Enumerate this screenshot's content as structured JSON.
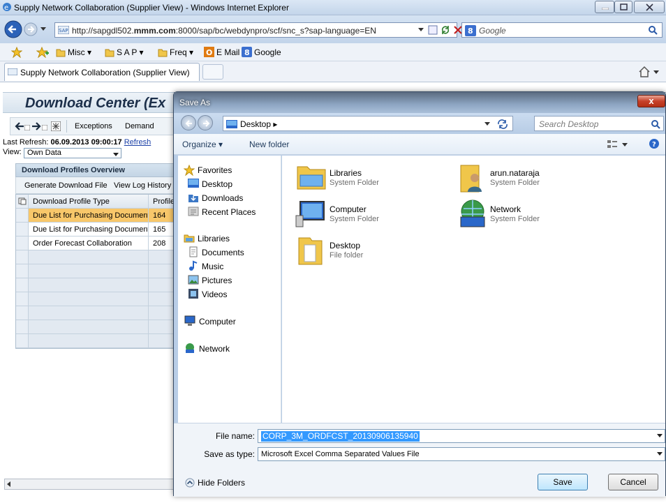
{
  "browser": {
    "window_title": "Supply Network Collaboration (Supplier View) - Windows Internet Explorer",
    "url_prefix": "http://sapgdl502.",
    "url_bold": "mmm.com",
    "url_suffix": ":8000/sap/bc/webdynpro/scf/snc_s?sap-language=EN",
    "search_placeholder": "Google",
    "favorites": [
      "Misc ▾",
      "S A P ▾",
      "Freq ▾",
      "E Mail",
      "Google"
    ],
    "tab_title": "Supply Network Collaboration (Supplier View)"
  },
  "sap": {
    "page_title": "Download Center (Ex",
    "toolbar": [
      "Exceptions",
      "Demand"
    ],
    "last_refresh_label": "Last Refresh: ",
    "last_refresh_value": "06.09.2013 09:00:17",
    "refresh_link": "Refresh",
    "view_label": "View:",
    "view_value": "Own Data",
    "overview_title": "Download Profiles Overview",
    "overview_actions": [
      "Generate Download File",
      "View Log",
      "History"
    ],
    "table": {
      "headers": [
        "Download Profile Type",
        "Profile"
      ],
      "rows": [
        [
          "Due List for Purchasing Documents",
          "164"
        ],
        [
          "Due List for Purchasing Documents",
          "165"
        ],
        [
          "Order Forecast Collaboration",
          "208"
        ]
      ]
    }
  },
  "dialog": {
    "title": "Save As",
    "close": "x",
    "breadcrumb": "Desktop",
    "search_placeholder": "Search Desktop",
    "organize": "Organize ▾",
    "new_folder": "New folder",
    "nav": {
      "favorites": "Favorites",
      "desktop": "Desktop",
      "downloads": "Downloads",
      "recent": "Recent Places",
      "libraries": "Libraries",
      "documents": "Documents",
      "music": "Music",
      "pictures": "Pictures",
      "videos": "Videos",
      "computer": "Computer",
      "network": "Network"
    },
    "items": [
      {
        "name": "Libraries",
        "type": "System Folder"
      },
      {
        "name": "arun.nataraja",
        "type": "System Folder"
      },
      {
        "name": "Computer",
        "type": "System Folder"
      },
      {
        "name": "Network",
        "type": "System Folder"
      },
      {
        "name": "Desktop",
        "type": "File folder"
      }
    ],
    "file_name_label": "File name:",
    "file_name_value": "CORP_3M_ORDFCST_20130906135940",
    "save_type_label": "Save as type:",
    "save_type_value": "Microsoft Excel Comma Separated Values File",
    "hide_folders": "Hide Folders",
    "save_btn": "Save",
    "cancel_btn": "Cancel"
  }
}
